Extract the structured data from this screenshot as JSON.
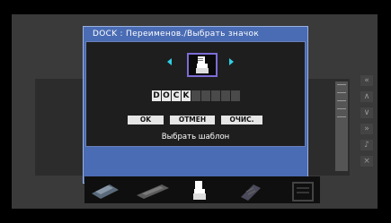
{
  "dialog": {
    "title": "DOCK : Переименов./Выбрать значок",
    "name_chars": [
      "D",
      "O",
      "C",
      "K",
      "",
      "",
      "",
      "",
      ""
    ],
    "buttons": {
      "ok": "OK",
      "cancel": "ОТМЕН",
      "clear": "ОЧИС."
    },
    "select_template": "Выбрать шаблон",
    "selected_icon": "dock-icon"
  },
  "tray": {
    "items": [
      "tank-icon",
      "keyboard-icon",
      "dock-icon",
      "hand-icon",
      "document-icon"
    ],
    "selected": "dock-icon"
  },
  "colors": {
    "dialog_bg": "#4a6cb4",
    "inner_bg": "#1e1e1e",
    "icon_frame": "#7c6cd6",
    "arrows": "#2fd0e6"
  }
}
